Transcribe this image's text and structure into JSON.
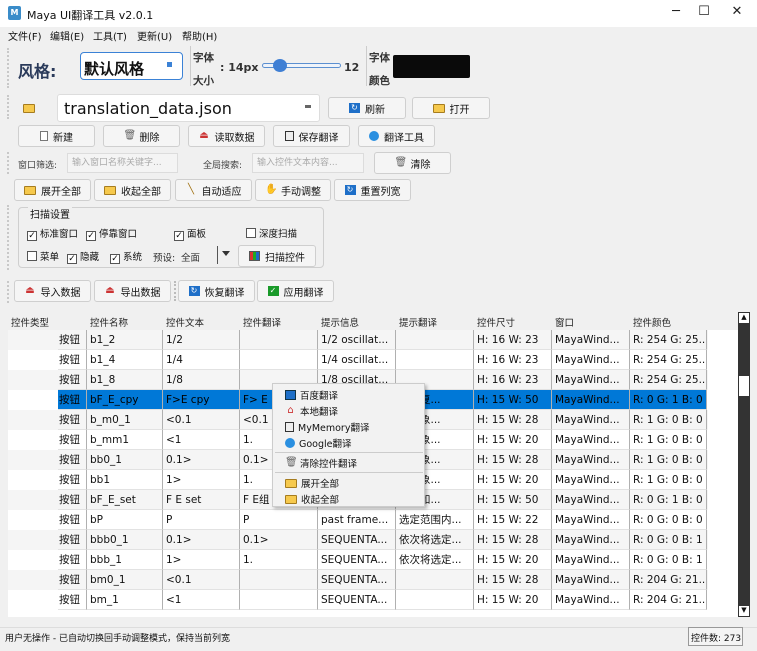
{
  "window": {
    "title": "Maya UI翻译工具 v2.0.1",
    "icon": "maya-icon",
    "controls": [
      "minimize",
      "maximize",
      "close"
    ]
  },
  "menu": [
    "文件(F)",
    "编辑(E)",
    "工具(T)",
    "更新(U)",
    "帮助(H)"
  ],
  "style_bar": {
    "style_label": "风格:",
    "style_value": "默认风格",
    "font_size_label1": "字体",
    "font_size_label2": "大小",
    "font_size_value": ": 14px",
    "slider_value": 12,
    "slider_min": 8,
    "slider_max": 30,
    "font_color_label1": "字体",
    "font_color_label2": "颜色",
    "font_color": "#0a0a0a"
  },
  "file_bar": {
    "file": "translation_data.json",
    "refresh": "刷新",
    "open": "打开"
  },
  "actions": {
    "new": "新建",
    "delete": "删除",
    "read": "读取数据",
    "save": "保存翻译",
    "translate_tool": "翻译工具"
  },
  "filters": {
    "window_label": "窗口筛选:",
    "window_placeholder": "输入窗口名称关键字...",
    "search_label": "全局搜索:",
    "search_placeholder": "输入控件文本内容...",
    "clear": "清除"
  },
  "view": {
    "expand_all": "展开全部",
    "collapse_all": "收起全部",
    "auto_fit": "自动适应",
    "manual": "手动调整",
    "reset_cols": "重置列宽"
  },
  "scan": {
    "title": "扫描设置",
    "options": [
      {
        "label": "标准窗口",
        "checked": true
      },
      {
        "label": "停靠窗口",
        "checked": true
      },
      {
        "label": "面板",
        "checked": true
      },
      {
        "label": "深度扫描",
        "checked": false
      },
      {
        "label": "菜单",
        "checked": false
      },
      {
        "label": "隐藏",
        "checked": true
      },
      {
        "label": "系统",
        "checked": true
      }
    ],
    "preset_label": "预设:",
    "preset_value": "全面",
    "scan_button": "扫描控件"
  },
  "data_bar": {
    "import": "导入数据",
    "export": "导出数据",
    "restore": "恢复翻译",
    "apply": "应用翻译"
  },
  "table": {
    "columns": [
      "控件类型",
      "控件名称",
      "控件文本",
      "控件翻译",
      "提示信息",
      "提示翻译",
      "控件尺寸",
      "窗口",
      "控件颜色"
    ],
    "rows": [
      [
        "按钮",
        "b1_2",
        "1/2",
        "",
        "1/2 oscillat...",
        "",
        "H: 16 W: 23",
        "MayaWind...",
        "R: 254 G: 25..."
      ],
      [
        "按钮",
        "b1_4",
        "1/4",
        "",
        "1/4 oscillat...",
        "",
        "H: 16 W: 23",
        "MayaWind...",
        "R: 254 G: 25..."
      ],
      [
        "按钮",
        "b1_8",
        "1/8",
        "",
        "1/8 oscillat...",
        "",
        "H: 16 W: 23",
        "MayaWind...",
        "R: 254 G: 25..."
      ],
      [
        "按钮",
        "bF_E_cpy",
        "F>E cpy",
        "F> E",
        "",
        "一帧复...",
        "H: 15 W: 50",
        "MayaWind...",
        "R: 0 G: 1 B: 0"
      ],
      [
        "按钮",
        "b_m0_1",
        "<0.1",
        "<0.1",
        "",
        "定对象...",
        "H: 15 W: 28",
        "MayaWind...",
        "R: 1 G: 0 B: 0"
      ],
      [
        "按钮",
        "b_mm1",
        "<1",
        "1.",
        "",
        "定对象...",
        "H: 15 W: 20",
        "MayaWind...",
        "R: 1 G: 0 B: 0"
      ],
      [
        "按钮",
        "bb0_1",
        "0.1>",
        "0.1>",
        "",
        "定对象...",
        "H: 15 W: 28",
        "MayaWind...",
        "R: 1 G: 0 B: 0"
      ],
      [
        "按钮",
        "bb1",
        "1>",
        "1.",
        "",
        "定对象...",
        "H: 15 W: 20",
        "MayaWind...",
        "R: 1 G: 0 B: 0"
      ],
      [
        "按钮",
        "bF_E_set",
        "F E set",
        "F E组",
        "",
        "一帧和...",
        "H: 15 W: 50",
        "MayaWind...",
        "R: 0 G: 1 B: 0"
      ],
      [
        "按钮",
        "bP",
        "P",
        "P",
        "past frame...",
        "选定范围内...",
        "H: 15 W: 22",
        "MayaWind...",
        "R: 0 G: 0 B: 0"
      ],
      [
        "按钮",
        "bbb0_1",
        "0.1>",
        "0.1>",
        "SEQUENTA...",
        "依次将选定...",
        "H: 15 W: 28",
        "MayaWind...",
        "R: 0 G: 0 B: 1"
      ],
      [
        "按钮",
        "bbb_1",
        "1>",
        "1.",
        "SEQUENTA...",
        "依次将选定...",
        "H: 15 W: 20",
        "MayaWind...",
        "R: 0 G: 0 B: 1"
      ],
      [
        "按钮",
        "bm0_1",
        "<0.1",
        "",
        "SEQUENTA...",
        "",
        "H: 15 W: 28",
        "MayaWind...",
        "R: 204 G: 21..."
      ],
      [
        "按钮",
        "bm_1",
        "<1",
        "",
        "SEQUENTA...",
        "",
        "H: 15 W: 20",
        "MayaWind...",
        "R: 204 G: 21..."
      ]
    ],
    "selected_row": 3,
    "scroll_fraction": 0.2
  },
  "context_menu": {
    "items": [
      "百度翻译",
      "本地翻译",
      "MyMemory翻译",
      "Google翻译",
      "清除控件翻译",
      "展开全部",
      "收起全部"
    ]
  },
  "status": {
    "message": "用户无操作 - 已自动切换回手动调整模式，保持当前列宽",
    "count": "控件数: 273"
  }
}
